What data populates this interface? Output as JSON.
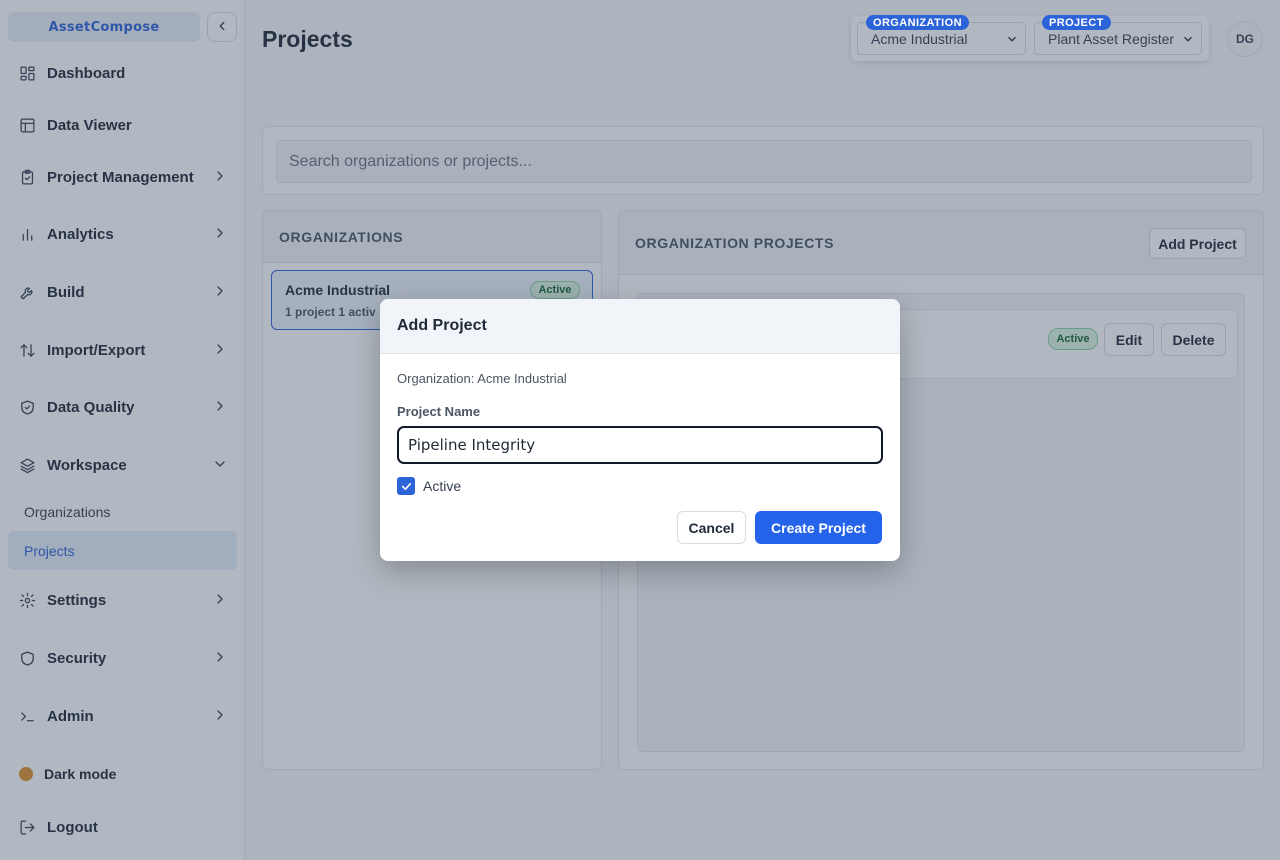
{
  "sidebar": {
    "brand": "AssetCompose",
    "nav": [
      {
        "label": "Dashboard",
        "icon": "dashboard-icon"
      },
      {
        "label": "Data Viewer",
        "icon": "table-icon"
      },
      {
        "label": "Project Management",
        "icon": "clipboard-icon"
      },
      {
        "label": "Analytics",
        "icon": "bar-chart-icon"
      },
      {
        "label": "Build",
        "icon": "wrench-icon"
      },
      {
        "label": "Import/Export",
        "icon": "arrows-up-down-icon"
      },
      {
        "label": "Data Quality",
        "icon": "shield-check-icon"
      },
      {
        "label": "Workspace",
        "icon": "layers-icon"
      },
      {
        "label": "Settings",
        "icon": "gear-icon"
      },
      {
        "label": "Security",
        "icon": "shield-icon"
      },
      {
        "label": "Admin",
        "icon": "terminal-icon"
      }
    ],
    "workspace_sub": [
      "Organizations",
      "Projects"
    ],
    "dark_mode": "Dark mode",
    "logout": "Logout"
  },
  "header": {
    "title": "Projects",
    "org_label": "ORGANIZATION",
    "org_value": "Acme Industrial",
    "project_label": "PROJECT",
    "project_value": "Plant Asset Register",
    "avatar": "DG"
  },
  "search": {
    "placeholder": "Search organizations or projects..."
  },
  "organizations": {
    "heading": "ORGANIZATIONS",
    "items": [
      {
        "name": "Acme Industrial",
        "meta": "1 project  1 activ",
        "status": "Active"
      }
    ]
  },
  "org_projects": {
    "heading": "ORGANIZATION PROJECTS",
    "add_label": "Add Project",
    "row": {
      "status": "Active",
      "edit": "Edit",
      "delete": "Delete"
    }
  },
  "modal": {
    "title": "Add Project",
    "organization": "Organization: Acme Industrial",
    "name_label": "Project Name",
    "name_value": "Pipeline Integrity",
    "active_label": "Active",
    "active_checked": true,
    "cancel": "Cancel",
    "create": "Create Project"
  },
  "colors": {
    "accent": "#2563eb",
    "overlay": "#34445c",
    "dark_mode_dot": "#e0902e"
  }
}
